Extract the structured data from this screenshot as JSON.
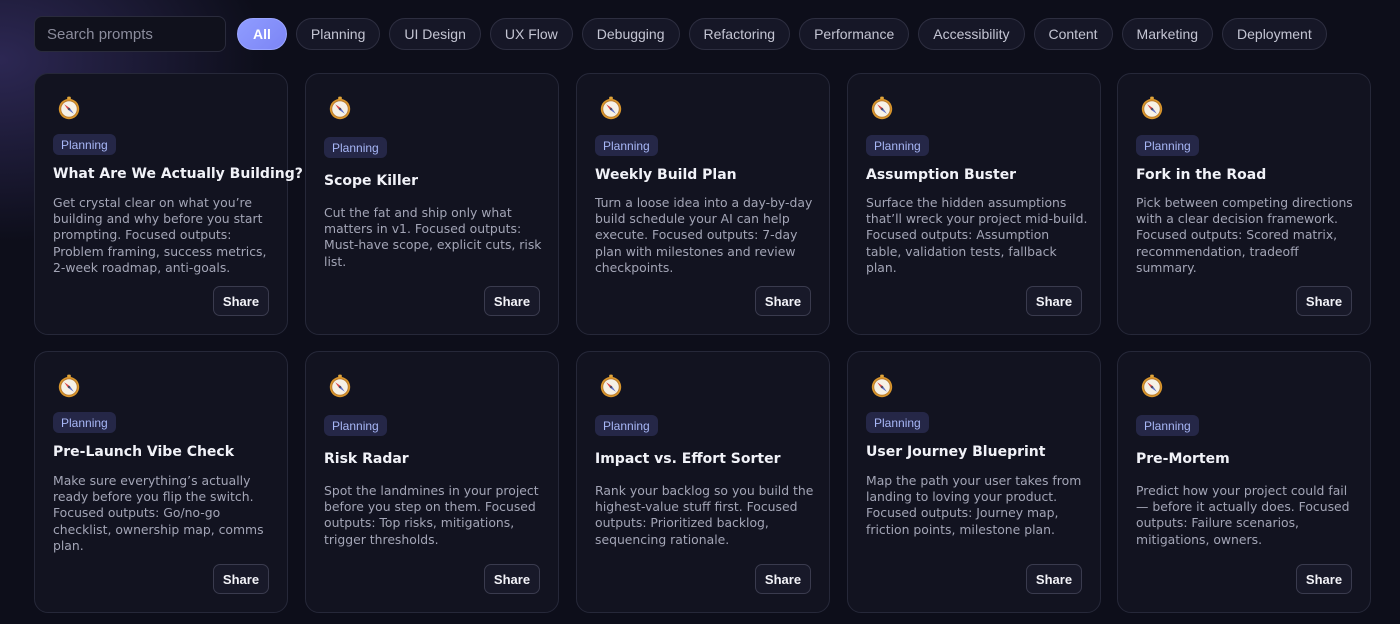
{
  "search": {
    "placeholder": "Search prompts"
  },
  "filters": [
    {
      "label": "All",
      "active": true
    },
    {
      "label": "Planning"
    },
    {
      "label": "UI Design"
    },
    {
      "label": "UX Flow"
    },
    {
      "label": "Debugging"
    },
    {
      "label": "Refactoring"
    },
    {
      "label": "Performance"
    },
    {
      "label": "Accessibility"
    },
    {
      "label": "Content"
    },
    {
      "label": "Marketing"
    },
    {
      "label": "Deployment"
    }
  ],
  "cards": [
    {
      "category": "Planning",
      "icon": "compass-icon",
      "title": "What Are We Actually Building?",
      "description": "Get crystal clear on what you’re building and why before you start prompting. Focused outputs: Problem framing, success metrics, 2-week roadmap, anti-goals.",
      "share_label": "Share"
    },
    {
      "category": "Planning",
      "icon": "compass-icon",
      "title": "Scope Killer",
      "description": "Cut the fat and ship only what matters in v1. Focused outputs: Must-have scope, explicit cuts, risk list.",
      "share_label": "Share"
    },
    {
      "category": "Planning",
      "icon": "compass-icon",
      "title": "Weekly Build Plan",
      "description": "Turn a loose idea into a day-by-day build schedule your AI can help execute. Focused outputs: 7-day plan with milestones and review checkpoints.",
      "share_label": "Share"
    },
    {
      "category": "Planning",
      "icon": "compass-icon",
      "title": "Assumption Buster",
      "description": "Surface the hidden assumptions that’ll wreck your project mid-build. Focused outputs: Assumption table, validation tests, fallback plan.",
      "share_label": "Share"
    },
    {
      "category": "Planning",
      "icon": "compass-icon",
      "title": "Fork in the Road",
      "description": "Pick between competing directions with a clear decision framework. Focused outputs: Scored matrix, recommendation, tradeoff summary.",
      "share_label": "Share"
    },
    {
      "category": "Planning",
      "icon": "compass-icon",
      "title": "Pre-Launch Vibe Check",
      "description": "Make sure everything’s actually ready before you flip the switch. Focused outputs: Go/no-go checklist, ownership map, comms plan.",
      "share_label": "Share"
    },
    {
      "category": "Planning",
      "icon": "compass-icon",
      "title": "Risk Radar",
      "description": "Spot the landmines in your project before you step on them. Focused outputs: Top risks, mitigations, trigger thresholds.",
      "share_label": "Share"
    },
    {
      "category": "Planning",
      "icon": "compass-icon",
      "title": "Impact vs. Effort Sorter",
      "description": "Rank your backlog so you build the highest-value stuff first. Focused outputs: Prioritized backlog, sequencing rationale.",
      "share_label": "Share"
    },
    {
      "category": "Planning",
      "icon": "compass-icon",
      "title": "User Journey Blueprint",
      "description": "Map the path your user takes from landing to loving your product. Focused outputs: Journey map, friction points, milestone plan.",
      "share_label": "Share"
    },
    {
      "category": "Planning",
      "icon": "compass-icon",
      "title": "Pre-Mortem",
      "description": "Predict how your project could fail — before it actually does. Focused outputs: Failure scenarios, mitigations, owners.",
      "share_label": "Share"
    }
  ]
}
